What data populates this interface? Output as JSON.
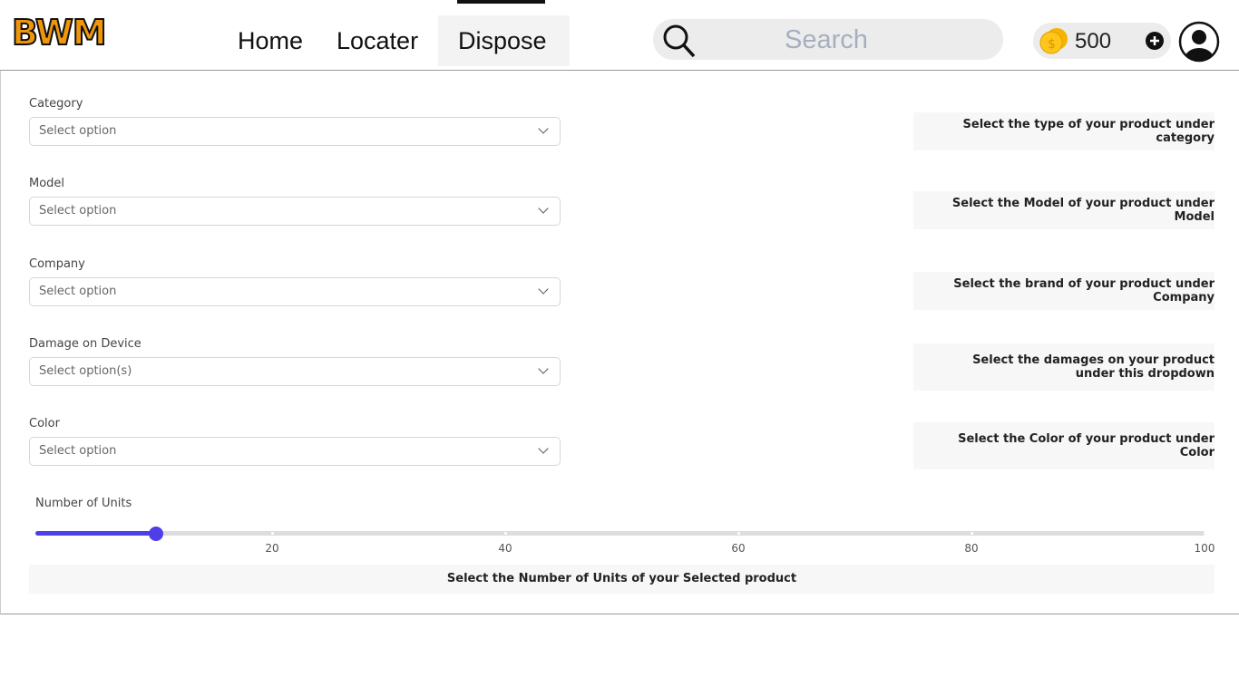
{
  "header": {
    "logo": "BWM",
    "nav": [
      {
        "label": "Home"
      },
      {
        "label": "Locater"
      },
      {
        "label": "Dispose",
        "active": true
      }
    ],
    "search_placeholder": "Search",
    "coins": "500",
    "accent": "#4f3fe6",
    "logo_color": "#f0960a"
  },
  "form": {
    "fields": [
      {
        "label": "Category",
        "placeholder": "Select option",
        "hint": "Select the type of your product under category"
      },
      {
        "label": "Model",
        "placeholder": "Select option",
        "hint": "Select the Model of your product under Model"
      },
      {
        "label": "Company",
        "placeholder": "Select option",
        "hint": "Select the brand of your product under Company"
      },
      {
        "label": "Damage on Device",
        "placeholder": "Select option(s)",
        "hint": "Select the damages on your product under this dropdown"
      },
      {
        "label": "Color",
        "placeholder": "Select option",
        "hint": "Select the Color of your product under Color"
      }
    ],
    "units": {
      "label": "Number of Units",
      "value": 10,
      "min": 0,
      "max": 100,
      "ticks": [
        "20",
        "40",
        "60",
        "80",
        "100"
      ],
      "hint": "Select the Number of Units of your Selected product"
    }
  }
}
